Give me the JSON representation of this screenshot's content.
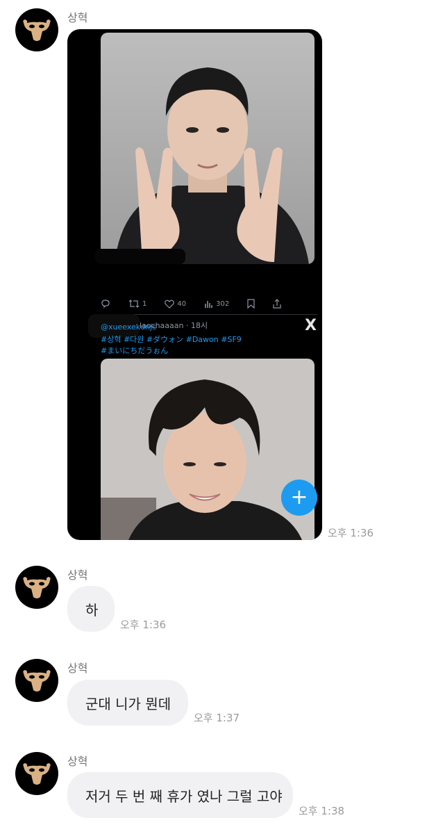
{
  "sender_name": "상혁",
  "messages": [
    {
      "type": "image",
      "time": "오후 1:36"
    },
    {
      "type": "text",
      "text": "하",
      "time": "오후 1:36"
    },
    {
      "type": "text",
      "text": "군대 니가 뭔데",
      "time": "오후 1:37"
    },
    {
      "type": "text",
      "text": "저거 두 번 째 휴가 였나 그럴 고야",
      "time": "오후 1:38"
    }
  ],
  "screenshot": {
    "stats": {
      "retweets": "1",
      "likes": "40",
      "views": "302"
    },
    "handle_line": "laochaaaan · 18시",
    "mention": "@xueexekdnjs",
    "tags_line1": "#상혁 #다원 #ダウォン #Dawon #SF9",
    "tags_line2": "#まいにちだうぉん",
    "fab_label": "+",
    "x_logo": "X"
  },
  "colors": {
    "bubble": "#f1f1f3",
    "accent": "#1d9bf0",
    "time": "#9a9a9a"
  }
}
